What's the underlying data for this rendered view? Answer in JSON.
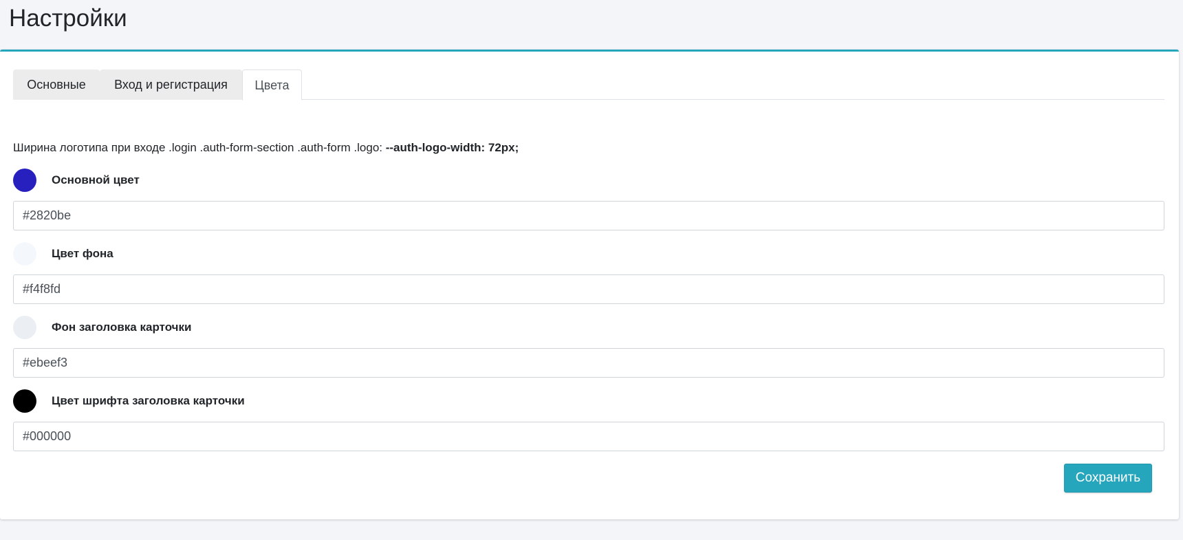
{
  "page": {
    "title": "Настройки"
  },
  "tabs": [
    {
      "label": "Основные",
      "active": false
    },
    {
      "label": "Вход и регистрация",
      "active": false
    },
    {
      "label": "Цвета",
      "active": true
    }
  ],
  "hint": {
    "text": "Ширина логотипа при входе .login .auth-form-section .auth-form .logo: ",
    "code": "--auth-logo-width: 72px;"
  },
  "colors": [
    {
      "label": "Основной цвет",
      "value": "#2820be",
      "swatch": "#2820be"
    },
    {
      "label": "Цвет фона",
      "value": "#f4f8fd",
      "swatch": "#f4f8fd"
    },
    {
      "label": "Фон заголовка карточки",
      "value": "#ebeef3",
      "swatch": "#ebeef3"
    },
    {
      "label": "Цвет шрифта заголовка карточки",
      "value": "#000000",
      "swatch": "#000000"
    }
  ],
  "actions": {
    "save_label": "Сохранить"
  },
  "theme": {
    "accent": "#25a6bd",
    "page_background": "#f4f5f9"
  }
}
